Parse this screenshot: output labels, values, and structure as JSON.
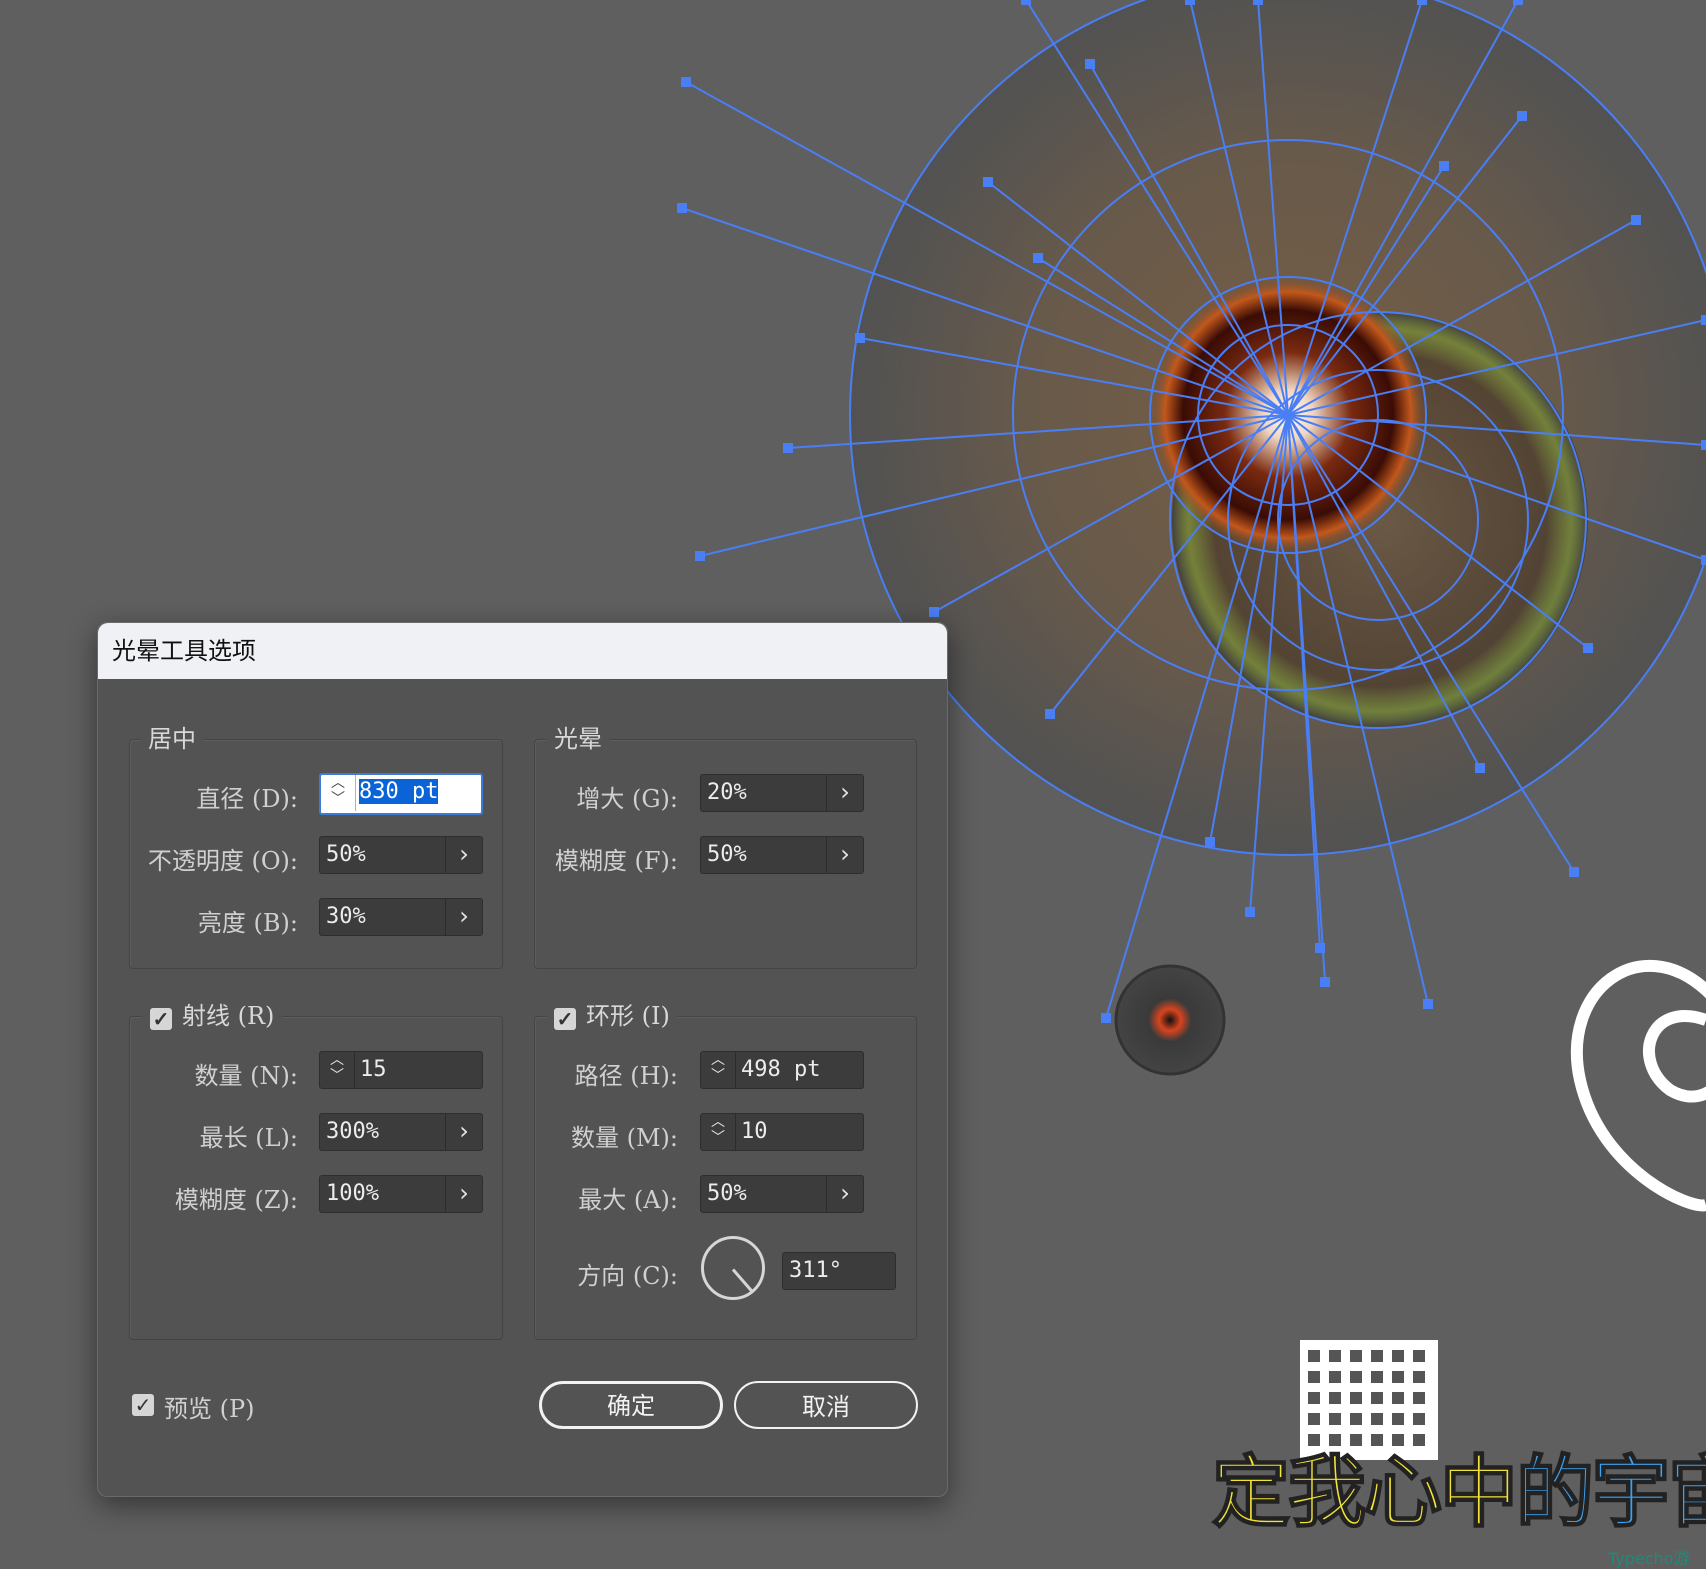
{
  "dialog": {
    "title": "光晕工具选项",
    "center_group": {
      "legend": "居中",
      "diameter_label": "直径 (D):",
      "diameter_value": "830 pt",
      "opacity_label": "不透明度 (O):",
      "opacity_value": "50%",
      "brightness_label": "亮度 (B):",
      "brightness_value": "30%"
    },
    "halo_group": {
      "legend": "光晕",
      "growth_label": "增大 (G):",
      "growth_value": "20%",
      "fuzziness_label": "模糊度 (F):",
      "fuzziness_value": "50%"
    },
    "rays_group": {
      "legend": "射线 (R)",
      "checked": true,
      "number_label": "数量 (N):",
      "number_value": "15",
      "longest_label": "最长 (L):",
      "longest_value": "300%",
      "fuzziness_label": "模糊度 (Z):",
      "fuzziness_value": "100%"
    },
    "rings_group": {
      "legend": "环形 (I)",
      "checked": true,
      "path_label": "路径 (H):",
      "path_value": "498 pt",
      "number_label": "数量 (M):",
      "number_value": "10",
      "largest_label": "最大 (A):",
      "largest_value": "50%",
      "direction_label": "方向 (C):",
      "direction_value": "311°",
      "direction_degrees": 311
    },
    "preview_label": "预览 (P)",
    "preview_checked": true,
    "ok_label": "确定",
    "cancel_label": "取消"
  },
  "canvas": {
    "caption_yellow": "定我心中",
    "caption_blue": "的宇宙",
    "watermark": "Typecho游"
  },
  "icons": {
    "spin": "up-down-stepper-icon",
    "arrow": "chevron-right-icon",
    "check": "checkmark-icon"
  },
  "colors": {
    "selection_blue": "#4a7ef5",
    "caption_yellow": "#f2e33a",
    "caption_blue": "#3fa2f0"
  }
}
